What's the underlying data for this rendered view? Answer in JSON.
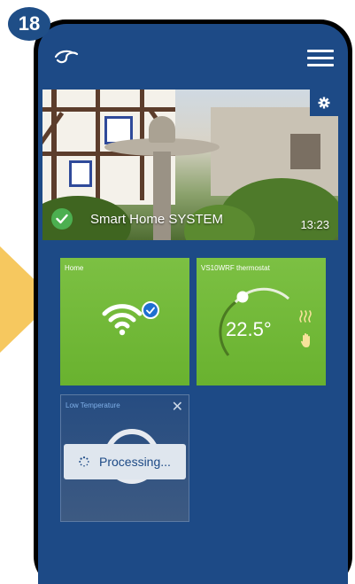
{
  "step_number": "18",
  "colors": {
    "screen_bg": "#1d4a86",
    "tile_green": "#6fb535",
    "accent_yellow": "#f6c85f"
  },
  "header": {
    "logo_icon": "salus-logo-icon",
    "menu_icon": "hamburger-menu-icon"
  },
  "hero": {
    "system_name": "Smart Home SYSTEM",
    "time": "13:23",
    "status_icon": "check-circle-icon",
    "settings_icon": "gear-icon"
  },
  "tiles": {
    "home": {
      "label": "Home",
      "icon": "wifi-icon",
      "badge_icon": "check-badge-icon"
    },
    "thermostat": {
      "label": "VS10WRF thermostat",
      "temperature": "22.5°",
      "mode_icons": [
        "heating-icon",
        "manual-hand-icon"
      ]
    },
    "alert": {
      "label": "Low Temperature",
      "close_icon": "close-icon"
    }
  },
  "processing": {
    "text": "Processing..."
  }
}
